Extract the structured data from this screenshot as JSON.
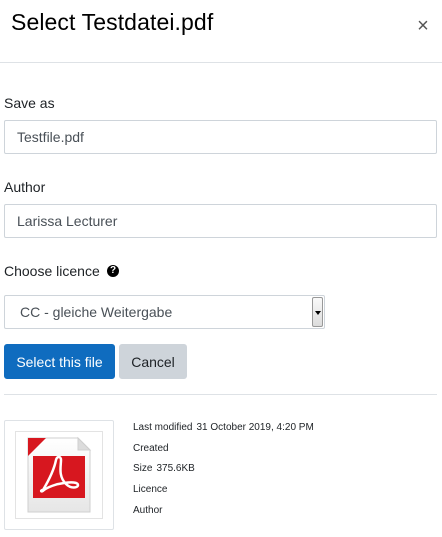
{
  "dialog": {
    "title": "Select Testdatei.pdf",
    "close_label": "×"
  },
  "form": {
    "save_as_label": "Save as",
    "save_as_value": "Testfile.pdf",
    "author_label": "Author",
    "author_value": "Larissa Lecturer",
    "licence_label": "Choose licence",
    "licence_value": "CC - gleiche Weitergabe",
    "help_glyph": "?"
  },
  "buttons": {
    "select": "Select this file",
    "cancel": "Cancel"
  },
  "file_info": {
    "thumbnail_icon": "pdf-file-icon",
    "last_modified_label": "Last modified",
    "last_modified_value": "31 October 2019, 4:20 PM",
    "created_label": "Created",
    "size_label": "Size",
    "size_value": "375.6KB",
    "licence_label": "Licence",
    "author_label": "Author"
  },
  "colors": {
    "primary": "#0f6cbf",
    "secondary": "#ced4da",
    "pdf_red": "#d7171f"
  }
}
